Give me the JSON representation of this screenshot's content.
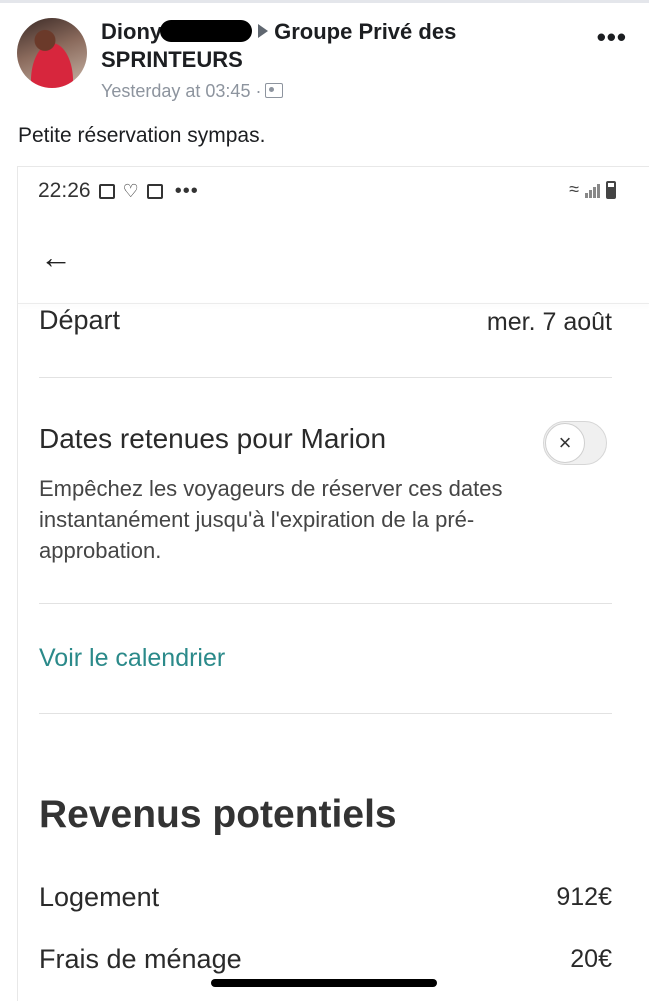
{
  "post": {
    "author_visible": "Diony",
    "group_line1": "Groupe Privé des",
    "group_line2": "SPRINTEURS",
    "time": "Yesterday at 03:45 ·",
    "privacy_icon": "friends-icon",
    "more_icon": "•••",
    "caption": "Petite réservation sympas."
  },
  "phone": {
    "status_time": "22:26",
    "status_icons": [
      "image-icon",
      "airbnb-icon",
      "mail-icon"
    ],
    "status_more": "•••",
    "back_icon": "←",
    "departure": {
      "label": "Départ",
      "value": "mer. 7 août"
    },
    "hold": {
      "title": "Dates retenues pour Marion",
      "description": "Empêchez les voyageurs de réserver ces dates instantanément jusqu'à l'expiration de la pré-approbation.",
      "toggle_state": "off",
      "toggle_glyph": "×"
    },
    "calendar_link": "Voir le calendrier",
    "revenue": {
      "title": "Revenus potentiels",
      "items": [
        {
          "label": "Logement",
          "value": "912€"
        },
        {
          "label": "Frais de ménage",
          "value": "20€"
        }
      ]
    }
  },
  "colors": {
    "link": "#2b8a8a",
    "meta": "#8d949e",
    "text": "#1c1e21"
  }
}
